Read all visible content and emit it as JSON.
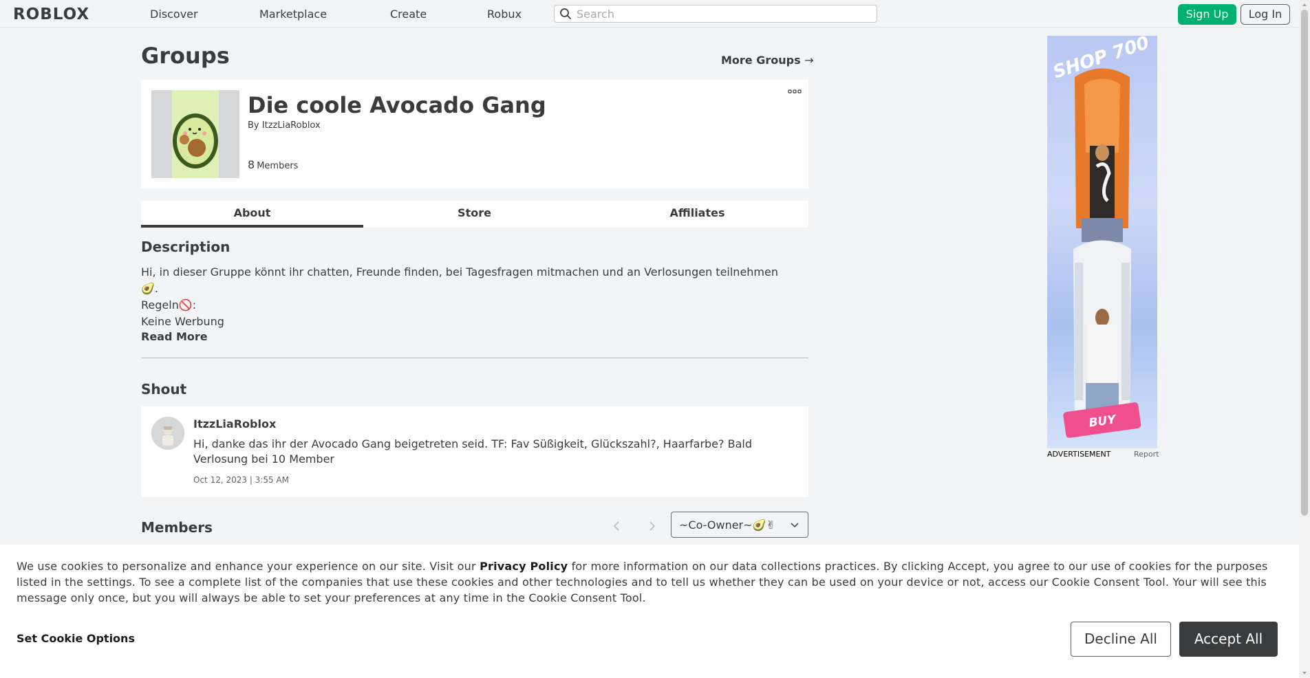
{
  "nav": {
    "logo": "ROBLOX",
    "links": [
      "Discover",
      "Marketplace",
      "Create",
      "Robux"
    ],
    "search_placeholder": "Search",
    "signup": "Sign Up",
    "login": "Log In"
  },
  "page": {
    "title": "Groups",
    "more_groups": "More Groups",
    "more_groups_arrow": "→"
  },
  "group": {
    "name": "Die coole Avocado Gang",
    "by_prefix": "By",
    "owner": "ItzzLiaRoblox",
    "member_count": "8",
    "members_label": "Members"
  },
  "tabs": [
    "About",
    "Store",
    "Affiliates"
  ],
  "description": {
    "heading": "Description",
    "line1": "Hi, in dieser Gruppe könnt ihr chatten, Freunde finden, bei Tagesfragen mitmachen und an Verlosungen teilnehmen🥑.",
    "line2": "Regeln🚫:",
    "line3": "Keine Werbung",
    "read_more": "Read More"
  },
  "shout": {
    "heading": "Shout",
    "user": "ItzzLiaRoblox",
    "body": "Hi, danke das ihr der Avocado Gang beigetreten seid. TF: Fav Süßigkeit, Glückszahl?, Haarfarbe? Bald Verlosung bei 10 Member",
    "date": "Oct 12, 2023 | 3:55 AM"
  },
  "members": {
    "heading": "Members",
    "role": "~Co-Owner~🥑✌"
  },
  "ad": {
    "headline": "SHOP 700",
    "cta": "BUY",
    "caption": "ADVERTISEMENT",
    "report": "Report"
  },
  "cookie": {
    "text_before": "We use cookies to personalize and enhance your experience on our site. Visit our ",
    "privacy_link": "Privacy Policy",
    "text_after": " for more information on our data collections practices. By clicking Accept, you agree to our use of cookies for the purposes listed in the settings. To see a complete list of the companies that use these cookies and other technologies and to tell us whether they can be used on your device or not, access our Cookie Consent Tool. Your will see this message only once, but you will always be able to set your preferences at any time in the Cookie Consent Tool.",
    "set_options": "Set Cookie Options",
    "decline": "Decline All",
    "accept": "Accept All"
  },
  "colors": {
    "primary_green": "#00b06f",
    "background": "#f2f4f5",
    "text": "#393b3d",
    "accept_bg": "#393b3d"
  }
}
